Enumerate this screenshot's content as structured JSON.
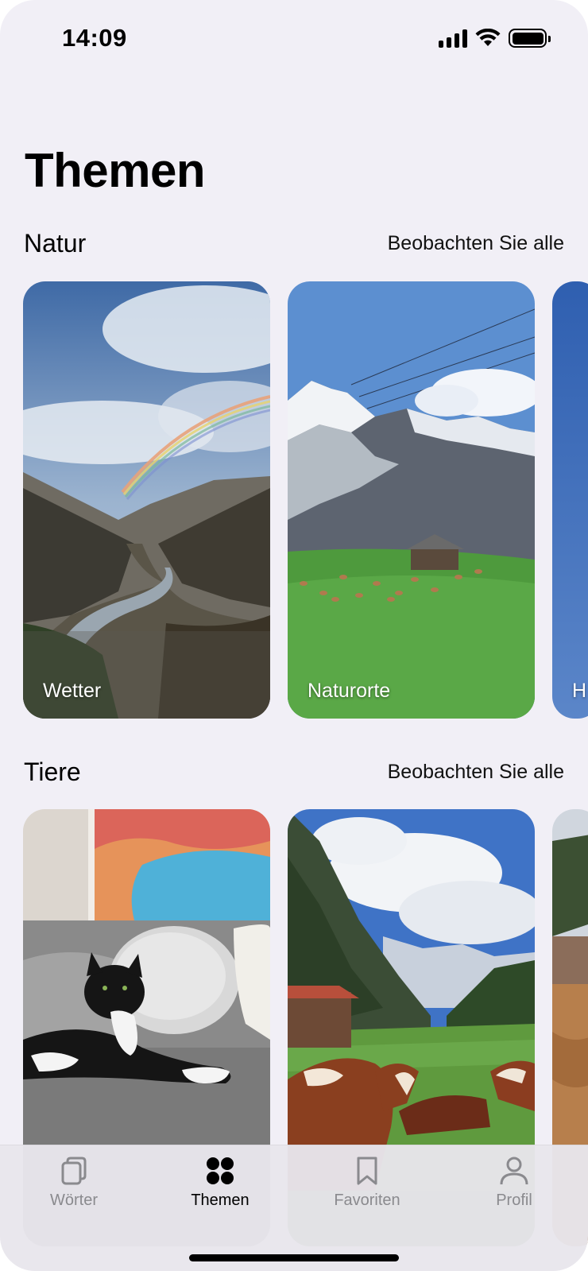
{
  "status_bar": {
    "time": "14:09"
  },
  "page": {
    "title": "Themen"
  },
  "sections": [
    {
      "title": "Natur",
      "see_all": "Beobachten Sie alle",
      "cards": [
        {
          "label": "Wetter"
        },
        {
          "label": "Naturorte"
        },
        {
          "label": "H"
        }
      ]
    },
    {
      "title": "Tiere",
      "see_all": "Beobachten Sie alle",
      "cards": [
        {
          "label": ""
        },
        {
          "label": ""
        },
        {
          "label": ""
        }
      ]
    }
  ],
  "tabbar": {
    "items": [
      {
        "label": "Wörter",
        "icon": "cards-icon",
        "active": false
      },
      {
        "label": "Themen",
        "icon": "grid-icon",
        "active": true
      },
      {
        "label": "Favoriten",
        "icon": "bookmark-icon",
        "active": false
      },
      {
        "label": "Profil",
        "icon": "person-icon",
        "active": false
      }
    ]
  }
}
